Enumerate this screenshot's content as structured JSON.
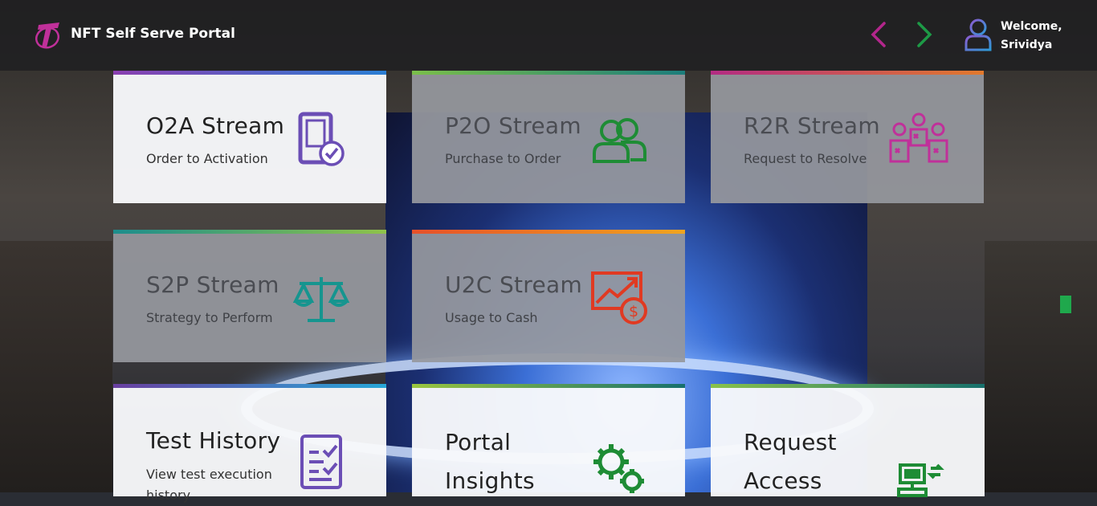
{
  "header": {
    "app_title": "NFT Self Serve Portal",
    "welcome_line1": "Welcome,",
    "welcome_line2": "Srividya"
  },
  "colors": {
    "nav_prev": "#b3268c",
    "nav_next": "#1d9a46",
    "user_icon_start": "#8b5bd0",
    "user_icon_end": "#2f9ad8"
  },
  "tiles": [
    {
      "title": "O2A Stream",
      "subtitle": "Order to Activation",
      "icon": "mobile-check-icon",
      "color": "#6b4eb5"
    },
    {
      "title": "P2O Stream",
      "subtitle": "Purchase to Order",
      "icon": "people-group-icon",
      "color": "#1e8c35"
    },
    {
      "title": "R2R Stream",
      "subtitle": "Request to Resolve",
      "icon": "team-tasks-icon",
      "color": "#c0309a"
    },
    {
      "title": "S2P Stream",
      "subtitle": "Strategy to Perform",
      "icon": "balance-scale-icon",
      "color": "#16958f"
    },
    {
      "title": "U2C Stream",
      "subtitle": "Usage to Cash",
      "icon": "chart-dollar-icon",
      "color": "#e03a22"
    },
    {
      "title": "Test History",
      "subtitle": "View test execution history",
      "icon": "checklist-icon",
      "color": "#6b4eb5"
    },
    {
      "title": "Portal Insights",
      "subtitle": "",
      "icon": "gears-icon",
      "color": "#1e8c35"
    },
    {
      "title": "Request Access",
      "subtitle": "",
      "icon": "computer-access-icon",
      "color": "#1e8c35"
    }
  ]
}
